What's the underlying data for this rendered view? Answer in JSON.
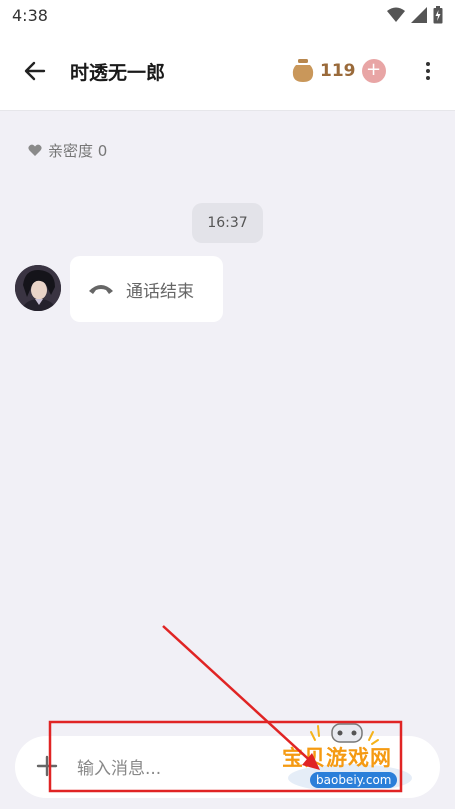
{
  "status_bar": {
    "time": "4:38",
    "icons": [
      "wifi-icon",
      "signal-icon",
      "battery-icon"
    ]
  },
  "header": {
    "title": "时透无一郎",
    "coin_count": "119",
    "coin_add_label": "+",
    "icons": {
      "back": "arrow-left-icon",
      "coin": "coin-jar-icon",
      "more": "more-vertical-icon"
    }
  },
  "chat": {
    "intimacy_label": "亲密度 0",
    "time_badge": "16:37",
    "messages": [
      {
        "type": "call",
        "text": "通话结束",
        "icon": "phone-hangup-icon"
      }
    ]
  },
  "input": {
    "placeholder": "输入消息...",
    "plus_label": "+"
  },
  "watermark": {
    "text": "宝贝游戏网",
    "domain": "baobeiy.com"
  },
  "colors": {
    "background": "#f1f0f6",
    "coin": "#9a6a3a",
    "coin_add": "#e8a5a5",
    "annotation": "#e02424",
    "watermark": "#f59a12"
  }
}
